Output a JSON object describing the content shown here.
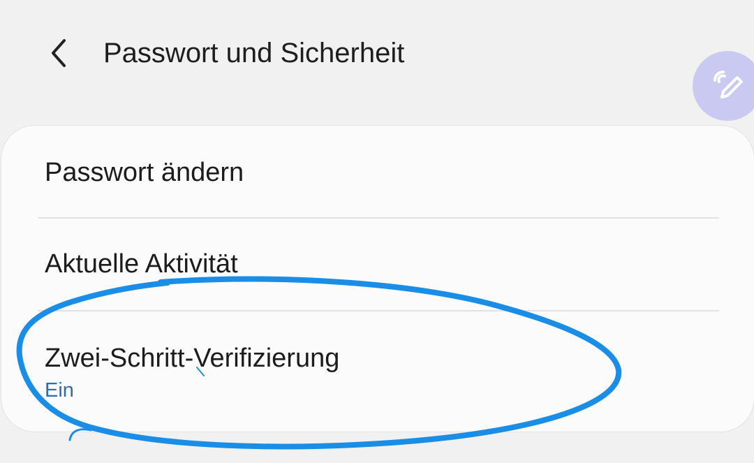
{
  "header": {
    "title": "Passwort und Sicherheit",
    "back_icon": "chevron-left-icon"
  },
  "floating_action": {
    "icon": "pen-icon",
    "color": "#c9c9f2"
  },
  "settings_list": {
    "items": [
      {
        "label": "Passwort ändern"
      },
      {
        "label": "Aktuelle Aktivität"
      },
      {
        "label": "Zwei-Schritt-Verifizierung",
        "status": "Ein"
      }
    ]
  },
  "colors": {
    "background": "#f1f1f1",
    "card": "#fbfbfb",
    "status_text": "#2b6fb3",
    "annotation_stroke": "#1a8ee6"
  }
}
